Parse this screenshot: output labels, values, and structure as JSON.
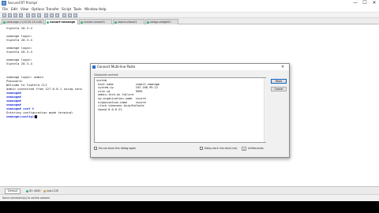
{
  "window": {
    "title": "SecureCRT Prompt",
    "minimize": "—",
    "maximize": "☐",
    "close": "✕"
  },
  "menu": [
    "File",
    "Edit",
    "View",
    "Options",
    "Transfer",
    "Script",
    "Tools",
    "Window",
    "Help"
  ],
  "tabs": [
    {
      "label": "vmanage-1 (10.25.15.144)",
      "color": "#3cb371",
      "active": false
    },
    {
      "label": "vsmart-vmanage",
      "color": "#3cb371",
      "active": true
    },
    {
      "label": "vsmart-vsmart1",
      "color": "#3cb371",
      "active": false
    },
    {
      "label": "vbond-vbond1",
      "color": "#3cb371",
      "active": false
    },
    {
      "label": "vedge-vedge01",
      "color": "#3cb371",
      "active": false
    }
  ],
  "terminal": {
    "lines": [
      {
        "text": "Viptela 20.3.4",
        "style": ""
      },
      {
        "text": "",
        "style": ""
      },
      {
        "text": "vmanage login:",
        "style": ""
      },
      {
        "text": "Viptela 20.3.4",
        "style": ""
      },
      {
        "text": "",
        "style": ""
      },
      {
        "text": "vmanage login:",
        "style": ""
      },
      {
        "text": "Viptela 20.3.4",
        "style": ""
      },
      {
        "text": "",
        "style": ""
      },
      {
        "text": "vmanage login:",
        "style": ""
      },
      {
        "text": "Viptela 20.3.4",
        "style": ""
      },
      {
        "text": "",
        "style": ""
      },
      {
        "text": "vmanage login: admin",
        "style": ""
      },
      {
        "text": "Password:",
        "style": ""
      },
      {
        "text": "Welcome to Viptela CLI",
        "style": ""
      },
      {
        "text": "admin connected from 127.0.0.1 using cons",
        "style": ""
      },
      {
        "text": "vmanage#",
        "style": "blue bold"
      },
      {
        "text": "vmanage#",
        "style": "blue bold"
      },
      {
        "text": "vmanage#",
        "style": "blue bold"
      },
      {
        "text": "vmanage#",
        "style": "blue bold"
      },
      {
        "text": "vmanage# conf t",
        "style": "blue bold"
      },
      {
        "text": "Entering configuration mode terminal",
        "style": ""
      },
      {
        "text": "vmanage(config)#",
        "style": "blue bold"
      }
    ]
  },
  "dialog": {
    "title": "Connect Multi-line Paste",
    "close": "✕",
    "group_label": "Clipboard content:",
    "lines": [
      "system",
      " host-name             vsmart-vmanage",
      " system-ip             192.168.99.12",
      " site-id               9999",
      " admin-tech-on-failure",
      " sp-organization-name  vscore",
      " organization-name     vscore",
      " clock timezone Asia/Kolkata",
      " vbond 0.0.0.21"
    ],
    "paste_button": "Paste",
    "cancel_button": "Cancel",
    "do_not_show_label": "Do not show this dialog again",
    "delay_label": "Delay each line send (ms)",
    "delay_value": "0",
    "milliseconds_label": "milliseconds"
  },
  "bottom": {
    "tab1": "Default",
    "tab2": "ID: 4400",
    "tab3": "sub-CCIE"
  },
  "status": {
    "text": "Send command(s) to active session"
  }
}
